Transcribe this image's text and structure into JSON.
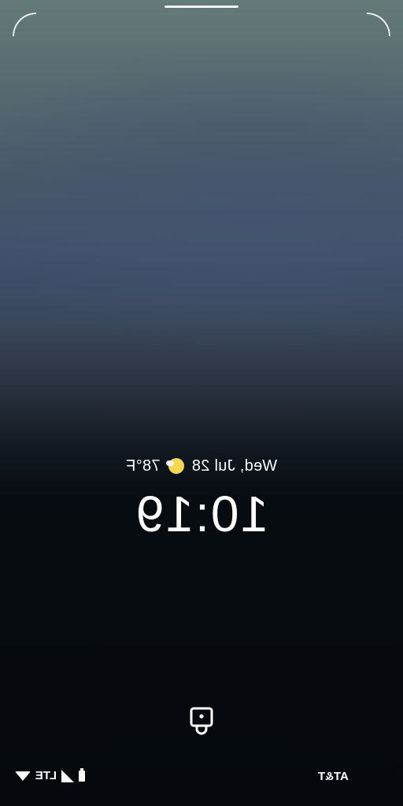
{
  "lockscreen": {
    "date_label": "Wed, Jul 28",
    "temperature": "78°F",
    "weather_icon": "sunny-partly-cloudy-icon",
    "time": "10:19",
    "lock_icon": "lock-icon"
  },
  "status_bar": {
    "carrier": "AT&T",
    "network": "LTE",
    "icons": [
      "wifi-icon",
      "cell-signal-icon",
      "battery-icon"
    ]
  },
  "colors": {
    "weather_sun": "#f6d84e",
    "background_top": "#647a78",
    "background_bottom": "#05090d"
  }
}
